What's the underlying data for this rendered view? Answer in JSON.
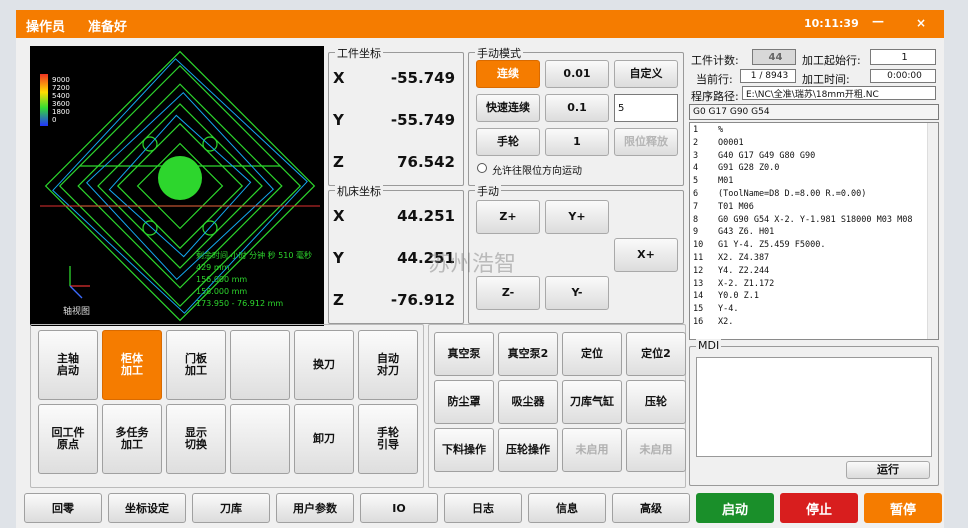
{
  "title": {
    "operator": "操作员",
    "status": "准备好",
    "time": "10:11:39",
    "minimize": "—",
    "close": "×"
  },
  "viewport": {
    "label": "轴视图",
    "legend": [
      "9000",
      "7200",
      "5400",
      "3600",
      "1800",
      "0"
    ],
    "overlay": [
      "剩余时间 小时 分钟 秒 510 毫秒",
      "429 mm",
      "156.000 mm",
      "158.000 mm",
      "173.950 - 76.912 mm"
    ],
    "watermark": "苏州浩智"
  },
  "work": {
    "label": "工件坐标",
    "axes": [
      "X",
      "Y",
      "Z"
    ],
    "values": [
      "-55.749",
      "-55.749",
      "76.542"
    ]
  },
  "machine": {
    "label": "机床坐标",
    "axes": [
      "X",
      "Y",
      "Z"
    ],
    "values": [
      "44.251",
      "44.251",
      "-76.912"
    ]
  },
  "manual_mode": {
    "label": "手动模式",
    "buttons": [
      "连续",
      "0.01",
      "自定义",
      "快速连续",
      "0.1",
      "手轮",
      "1",
      "限位释放"
    ],
    "custom_value": "5",
    "limit_text": "允许往限位方向运动"
  },
  "jog": {
    "label": "手动",
    "buttons": [
      "Z+",
      "Y+",
      "X+",
      "X-",
      "Z-",
      "Y-"
    ]
  },
  "info": {
    "count_label": "工件计数:",
    "count": "44",
    "start_line_label": "加工起始行:",
    "start_line": "1",
    "cur_line_label": "当前行:",
    "cur_line": "1 / 8943",
    "time_label": "加工时间:",
    "time": "0:00:00",
    "path_label": "程序路径:",
    "path": "E:\\NC\\全准\\瑞苏\\18mm开粗.NC",
    "modal": "G0 G17 G90 G54"
  },
  "program": {
    "lines": [
      [
        "1",
        "%"
      ],
      [
        "2",
        "O0001"
      ],
      [
        "3",
        "G40 G17 G49 G80 G90"
      ],
      [
        "4",
        "G91 G28 Z0.0"
      ],
      [
        "5",
        "M01"
      ],
      [
        "6",
        "(ToolName=D8 D.=8.00 R.=0.00)"
      ],
      [
        "7",
        "T01 M06"
      ],
      [
        "8",
        "G0 G90 G54 X-2. Y-1.981 S18000 M03 M08"
      ],
      [
        "9",
        "G43 Z6. H01"
      ],
      [
        "10",
        "G1 Y-4. Z5.459 F5000."
      ],
      [
        "11",
        "X2. Z4.387"
      ],
      [
        "12",
        "Y4. Z2.244"
      ],
      [
        "13",
        "X-2. Z1.172"
      ],
      [
        "14",
        "Y0.0 Z.1"
      ],
      [
        "15",
        "Y-4."
      ],
      [
        "16",
        "X2."
      ]
    ]
  },
  "mdi": {
    "label": "MDI",
    "run": "运行"
  },
  "func_buttons": [
    "主轴\n启动",
    "柜体\n加工",
    "门板\n加工",
    "",
    "换刀",
    "自动\n对刀",
    "回工件\n原点",
    "多任务\n加工",
    "显示\n切换",
    "",
    "卸刀",
    "手轮\n引导"
  ],
  "io_buttons": [
    "真空泵",
    "真空泵2",
    "定位",
    "定位2",
    "防尘罩",
    "吸尘器",
    "刀库气缸",
    "压轮",
    "下料操作",
    "压轮操作",
    "未启用",
    "未启用"
  ],
  "bottom": [
    "回零",
    "坐标设定",
    "刀库",
    "用户参数",
    "IO",
    "日志",
    "信息",
    "高级"
  ],
  "actions": {
    "start": "启动",
    "stop": "停止",
    "pause": "暂停"
  },
  "colors": {
    "accent": "#f57c00",
    "start": "#1a8f2a",
    "stop": "#d81e1e",
    "pause": "#f57c00"
  }
}
